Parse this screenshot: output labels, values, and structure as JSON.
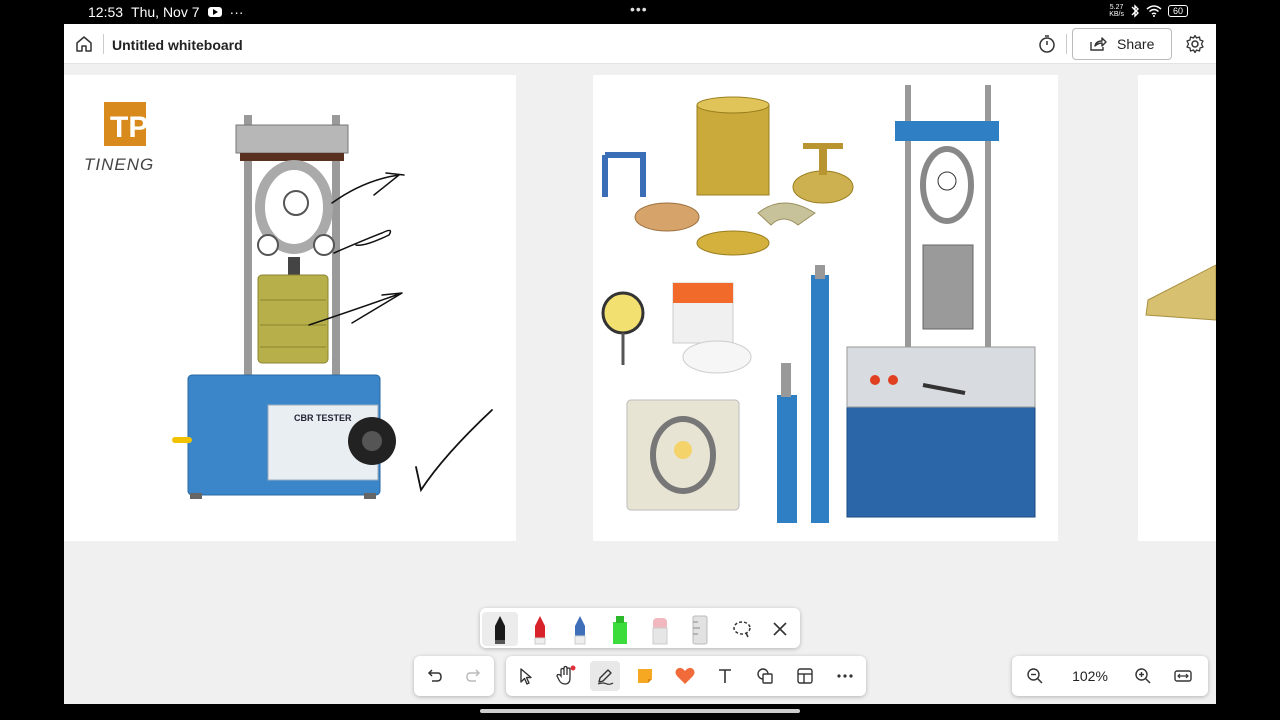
{
  "status_bar": {
    "time": "12:53",
    "date": "Thu, Nov 7",
    "more": "···",
    "center_dots": "•••",
    "net_speed_value": "5.27",
    "net_speed_unit": "KB/s",
    "battery": "60"
  },
  "app": {
    "title": "Untitled whiteboard",
    "share_label": "Share",
    "zoom": "102%"
  },
  "images": {
    "img1_logo_text": "TINENG",
    "img1_label": "CBR TESTER"
  },
  "pens": [
    {
      "name": "black-pen",
      "color": "#1a1a1a"
    },
    {
      "name": "red-pen",
      "color": "#d8232a"
    },
    {
      "name": "blue-pen",
      "color": "#3f6fb8"
    },
    {
      "name": "green-highlighter",
      "color": "#3ddc3d"
    },
    {
      "name": "pink-eraser",
      "color": "#f2b8c0"
    },
    {
      "name": "ruler",
      "color": "#cfcfcf"
    }
  ],
  "colors": {
    "accent_cbr_blue": "#3a86c8",
    "logo_orange": "#d98a1d",
    "reaction_heart": "#f06a3a",
    "sticky_note": "#f7a823"
  }
}
